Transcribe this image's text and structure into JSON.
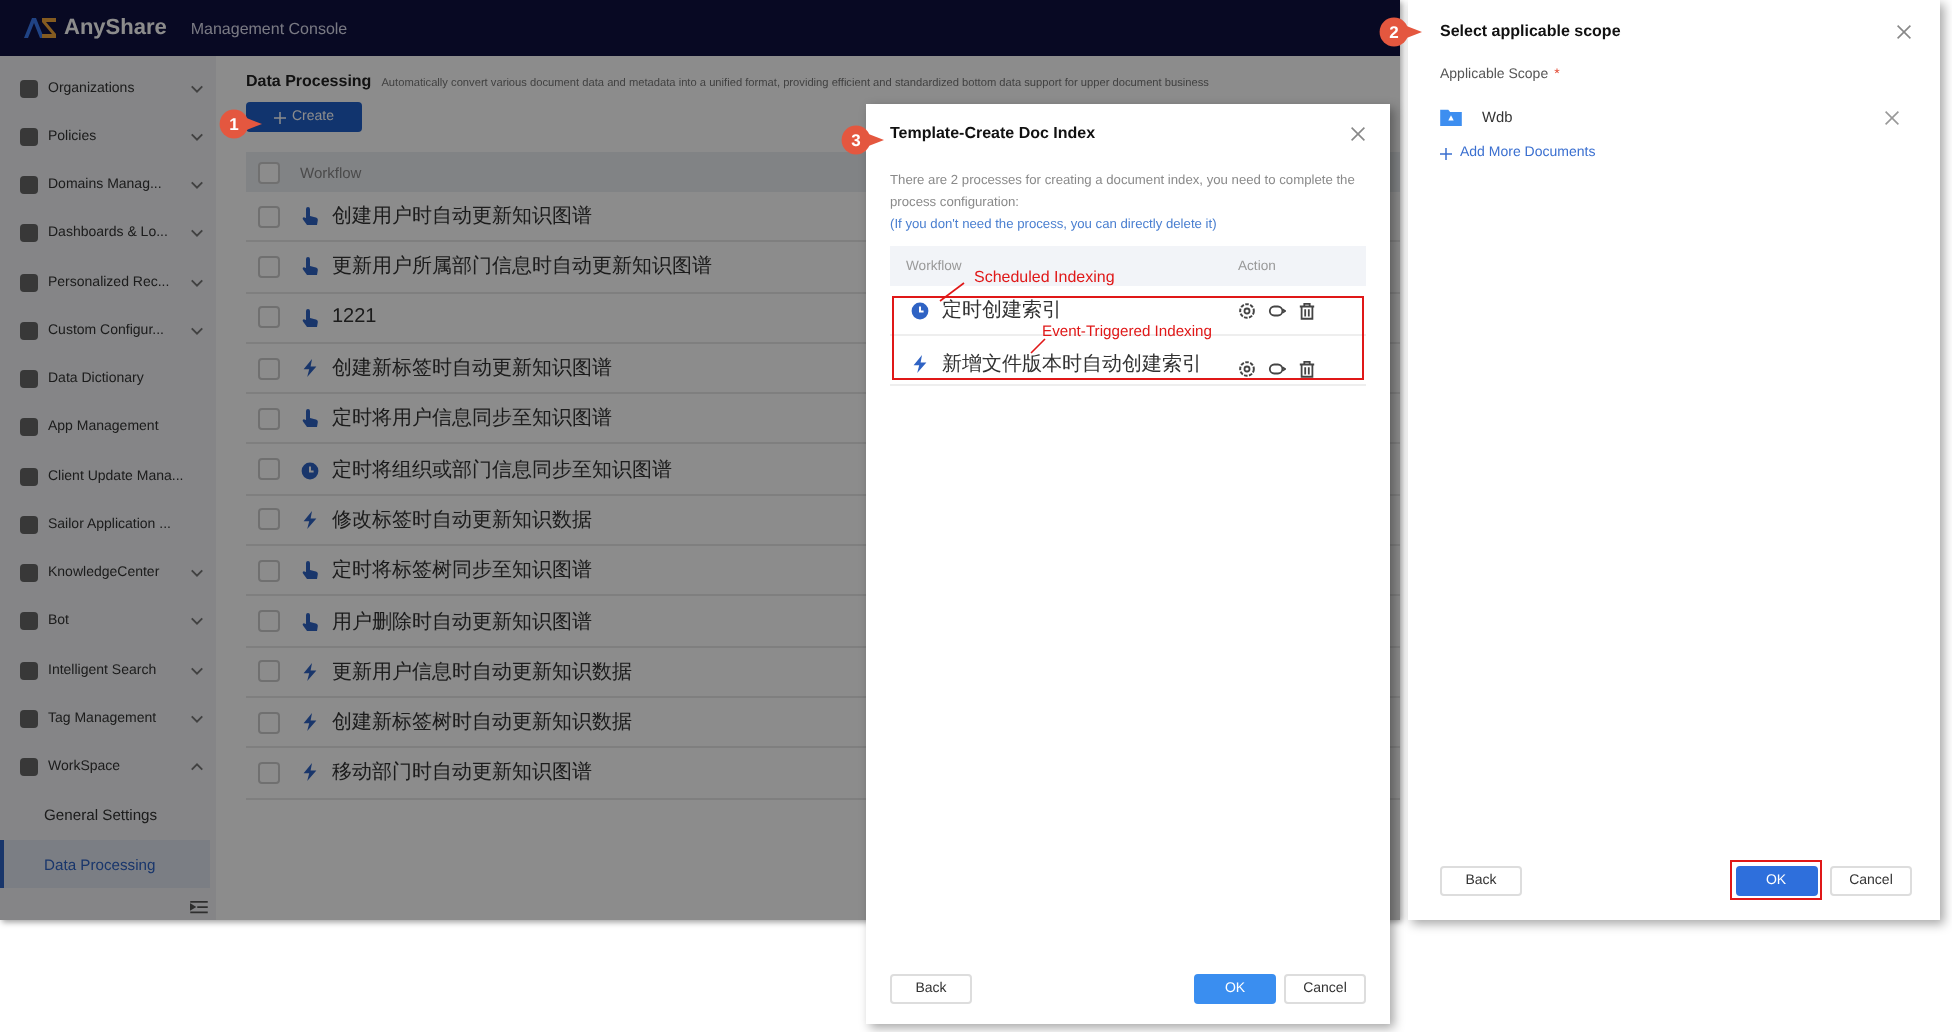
{
  "app": {
    "brand": "AnyShare",
    "console_title": "Management Console",
    "sidebar": {
      "items": [
        {
          "label": "Organizations",
          "kind": "group",
          "expanded": false
        },
        {
          "label": "Policies",
          "kind": "group",
          "expanded": false
        },
        {
          "label": "Domains Manag...",
          "kind": "group",
          "expanded": false
        },
        {
          "label": "Dashboards & Lo...",
          "kind": "group",
          "expanded": false
        },
        {
          "label": "Personalized Rec...",
          "kind": "group",
          "expanded": false
        },
        {
          "label": "Custom Configur...",
          "kind": "group",
          "expanded": false
        },
        {
          "label": "Data Dictionary",
          "kind": "link"
        },
        {
          "label": "App Management",
          "kind": "link"
        },
        {
          "label": "Client Update Mana...",
          "kind": "link"
        },
        {
          "label": "Sailor Application ...",
          "kind": "link"
        },
        {
          "label": "KnowledgeCenter",
          "kind": "group",
          "expanded": false
        },
        {
          "label": "Bot",
          "kind": "group",
          "expanded": false
        },
        {
          "label": "Intelligent Search",
          "kind": "group",
          "expanded": false
        },
        {
          "label": "Tag Management",
          "kind": "group",
          "expanded": false
        },
        {
          "label": "WorkSpace",
          "kind": "group",
          "expanded": true,
          "children": [
            {
              "label": "General Settings",
              "selected": false
            },
            {
              "label": "Data Processing",
              "selected": true
            }
          ]
        }
      ]
    },
    "page": {
      "title": "Data Processing",
      "description": "Automatically convert various document data and metadata into a unified format, providing efficient and standardized bottom data support for upper document business",
      "create_button": "Create",
      "table": {
        "select_all_checked": false,
        "columns": [
          "Workflow"
        ],
        "rows": [
          {
            "name": "创建用户时自动更新知识图谱",
            "kind": "manual",
            "checked": false
          },
          {
            "name": "更新用户所属部门信息时自动更新知识图谱",
            "kind": "manual",
            "checked": false
          },
          {
            "name": "1221",
            "kind": "manual",
            "checked": false
          },
          {
            "name": "创建新标签时自动更新知识图谱",
            "kind": "event",
            "checked": false
          },
          {
            "name": "定时将用户信息同步至知识图谱",
            "kind": "manual",
            "checked": false
          },
          {
            "name": "定时将组织或部门信息同步至知识图谱",
            "kind": "scheduled",
            "checked": false
          },
          {
            "name": "修改标签时自动更新知识数据",
            "kind": "event",
            "checked": false
          },
          {
            "name": "定时将标签树同步至知识图谱",
            "kind": "manual",
            "checked": false
          },
          {
            "name": "用户删除时自动更新知识图谱",
            "kind": "manual",
            "checked": false
          },
          {
            "name": "更新用户信息时自动更新知识数据",
            "kind": "event",
            "checked": false
          },
          {
            "name": "创建新标签树时自动更新知识数据",
            "kind": "event",
            "checked": false
          },
          {
            "name": "移动部门时自动更新知识图谱",
            "kind": "event",
            "checked": false
          }
        ]
      }
    }
  },
  "template_dialog": {
    "title": "Template-Create Doc Index",
    "description": "There are 2 processes for creating a document index, you need to complete the process configuration:",
    "hint": "(If you don't need the process, you can directly delete it)",
    "table": {
      "columns": [
        "Workflow",
        "Action"
      ],
      "rows": [
        {
          "name": "定时创建索引",
          "kind": "scheduled"
        },
        {
          "name": "新增文件版本时自动创建索引",
          "kind": "event"
        }
      ]
    },
    "buttons": [
      "Back",
      "OK",
      "Cancel"
    ]
  },
  "scope_panel": {
    "title": "Select applicable scope",
    "field_label": "Applicable Scope",
    "required_mark": "*",
    "documents": [
      "Wdb"
    ],
    "add_link": "Add More Documents",
    "buttons": [
      "Back",
      "OK",
      "Cancel"
    ]
  },
  "annotations": {
    "steps": [
      "1",
      "2",
      "3"
    ],
    "labels": [
      "Scheduled Indexing",
      "Event-Triggered Indexing"
    ]
  }
}
